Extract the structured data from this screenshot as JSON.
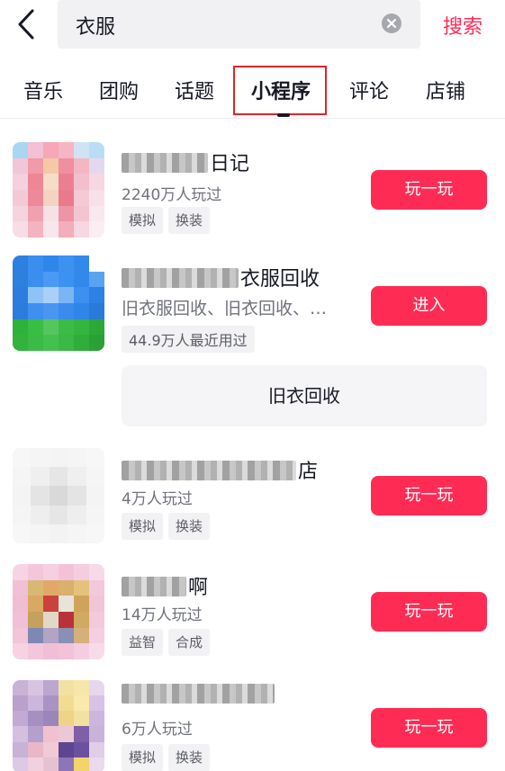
{
  "search": {
    "query": "衣服",
    "button_label": "搜索"
  },
  "tabs": [
    {
      "label": "音乐"
    },
    {
      "label": "团购"
    },
    {
      "label": "话题"
    },
    {
      "label": "小程序",
      "active": true
    },
    {
      "label": "评论"
    },
    {
      "label": "店铺"
    }
  ],
  "results": [
    {
      "title_visible": "日记",
      "stats": "2240万人玩过",
      "tags": [
        "模拟",
        "换装"
      ],
      "button": "玩一玩"
    },
    {
      "title_visible": "衣服回收",
      "description": "旧衣服回收、旧衣回收、…",
      "stats": "44.9万人最近用过",
      "button": "进入",
      "sub_button": "旧衣回收"
    },
    {
      "title_visible": "店",
      "stats": "4万人玩过",
      "tags": [
        "模拟",
        "换装"
      ],
      "button": "玩一玩"
    },
    {
      "title_visible": "啊",
      "stats": "14万人玩过",
      "tags": [
        "益智",
        "合成"
      ],
      "button": "玩一玩"
    },
    {
      "title_visible": "",
      "stats": "6万人玩过",
      "tags": [
        "模拟",
        "换装"
      ],
      "button": "玩一玩"
    }
  ],
  "colors": {
    "accent": "#fe2c55",
    "tab_highlight_border": "#d9262a"
  },
  "icons": [
    "back-arrow-icon",
    "clear-search-icon"
  ]
}
